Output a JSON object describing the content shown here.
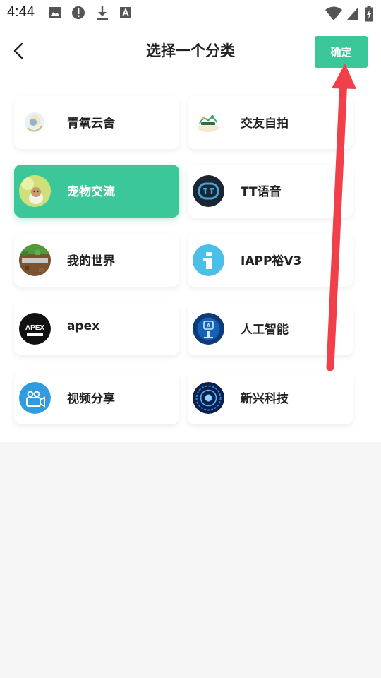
{
  "status_bar": {
    "time": "4:44",
    "icons": [
      "image-icon",
      "alert-icon",
      "download-icon",
      "a-box-icon",
      "wifi-icon",
      "signal-icon",
      "battery-icon"
    ]
  },
  "header": {
    "title": "选择一个分类",
    "confirm_label": "确定",
    "back_icon": "chevron-left-icon"
  },
  "categories": [
    {
      "label": "青氧云舍",
      "icon": "avatar-icon",
      "selected": false
    },
    {
      "label": "交友自拍",
      "icon": "avatar-icon",
      "selected": false
    },
    {
      "label": "宠物交流",
      "icon": "avatar-icon",
      "selected": true
    },
    {
      "label": "TT语音",
      "icon": "tt-logo-icon",
      "selected": false
    },
    {
      "label": "我的世界",
      "icon": "minecraft-logo-icon",
      "selected": false
    },
    {
      "label": "IAPP裕V3",
      "icon": "info-logo-icon",
      "selected": false
    },
    {
      "label": "apex",
      "icon": "apex-logo-icon",
      "selected": false
    },
    {
      "label": "人工智能",
      "icon": "ai-logo-icon",
      "selected": false
    },
    {
      "label": "视频分享",
      "icon": "video-camera-icon",
      "selected": false
    },
    {
      "label": "新兴科技",
      "icon": "tech-circle-icon",
      "selected": false
    }
  ],
  "colors": {
    "accent": "#3cc79a",
    "annotation_arrow": "#f2404a",
    "background": "#f5f5f5"
  }
}
